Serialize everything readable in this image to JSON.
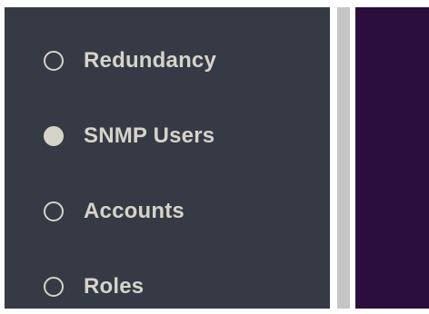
{
  "sidebar": {
    "items": [
      {
        "label": "Redundancy",
        "selected": false,
        "icon": "radio-unselected-icon"
      },
      {
        "label": "SNMP Users",
        "selected": true,
        "icon": "radio-selected-icon"
      },
      {
        "label": "Accounts",
        "selected": false,
        "icon": "radio-unselected-icon"
      },
      {
        "label": "Roles",
        "selected": false,
        "icon": "radio-unselected-icon"
      }
    ]
  },
  "colors": {
    "sidebar_bg": "#363a45",
    "item_text": "#d6d3c9",
    "scrollbar": "#c5c5c5",
    "content_bg": "#2b0e3d"
  }
}
